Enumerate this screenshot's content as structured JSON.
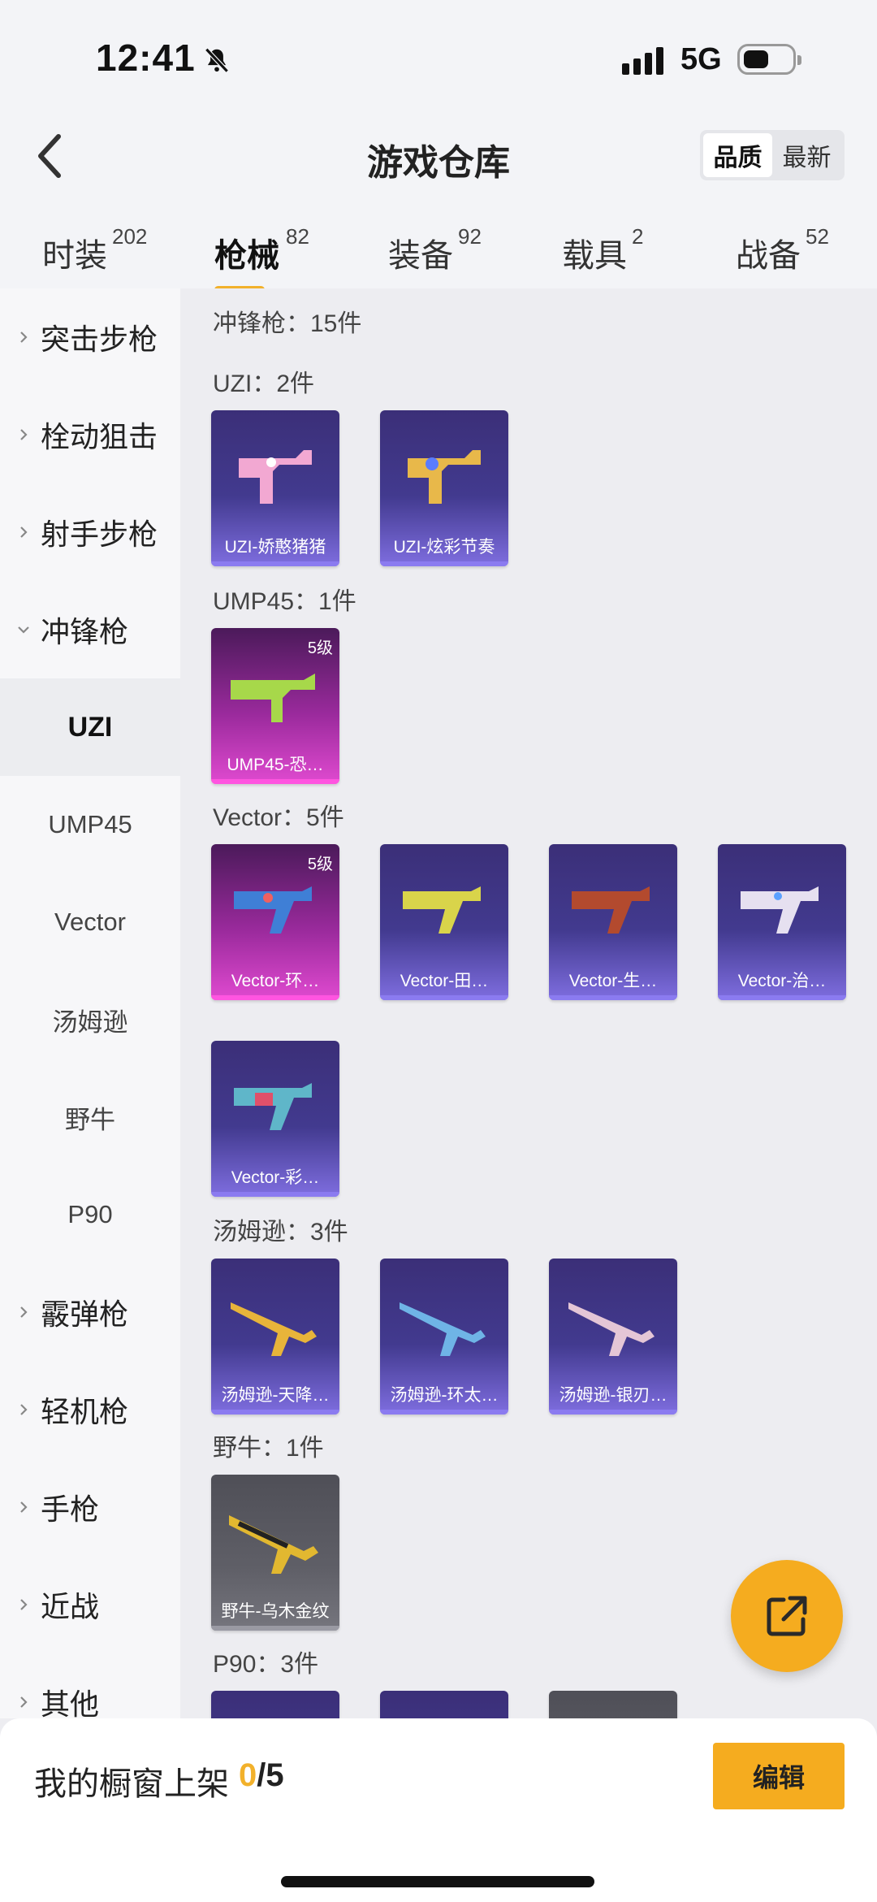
{
  "status_bar": {
    "time": "12:41",
    "network": "5G"
  },
  "header": {
    "title": "游戏仓库",
    "sort_options": [
      "品质",
      "最新"
    ]
  },
  "tabs": [
    {
      "label": "时装",
      "count": "202"
    },
    {
      "label": "枪械",
      "count": "82"
    },
    {
      "label": "装备",
      "count": "92"
    },
    {
      "label": "载具",
      "count": "2"
    },
    {
      "label": "战备",
      "count": "52"
    }
  ],
  "sidebar": {
    "categories": [
      "突击步枪",
      "栓动狙击",
      "射手步枪",
      "冲锋枪",
      "霰弹枪",
      "轻机枪",
      "手枪",
      "近战",
      "其他"
    ],
    "subcategories": [
      "UZI",
      "UMP45",
      "Vector",
      "汤姆逊",
      "野牛",
      "P90"
    ]
  },
  "main": {
    "summary": "冲锋枪：15件",
    "groups": [
      {
        "label": "UZI：2件",
        "items": [
          {
            "name": "UZI-娇憨猪猪",
            "level": ""
          },
          {
            "name": "UZI-炫彩节奏",
            "level": ""
          }
        ]
      },
      {
        "label": "UMP45：1件",
        "items": [
          {
            "name": "UMP45-恐…",
            "level": "5级"
          }
        ]
      },
      {
        "label": "Vector：5件",
        "items": [
          {
            "name": "Vector-环…",
            "level": "5级"
          },
          {
            "name": "Vector-田…",
            "level": ""
          },
          {
            "name": "Vector-生…",
            "level": ""
          },
          {
            "name": "Vector-治…",
            "level": ""
          },
          {
            "name": "Vector-彩…",
            "level": ""
          }
        ]
      },
      {
        "label": "汤姆逊：3件",
        "items": [
          {
            "name": "汤姆逊-天降…",
            "level": ""
          },
          {
            "name": "汤姆逊-环太…",
            "level": ""
          },
          {
            "name": "汤姆逊-银刃…",
            "level": ""
          }
        ]
      },
      {
        "label": "野牛：1件",
        "items": [
          {
            "name": "野牛-乌木金纹",
            "level": ""
          }
        ]
      },
      {
        "label": "P90：3件",
        "items": []
      }
    ]
  },
  "bottom_bar": {
    "label": "我的橱窗上架",
    "used": "0",
    "total": "/5",
    "edit_label": "编辑"
  },
  "colors": {
    "accent": "#f5ac1f",
    "rare_purple": "#423a8f",
    "epic_pink": "#c23cbc",
    "common_grey": "#5f5f67"
  }
}
